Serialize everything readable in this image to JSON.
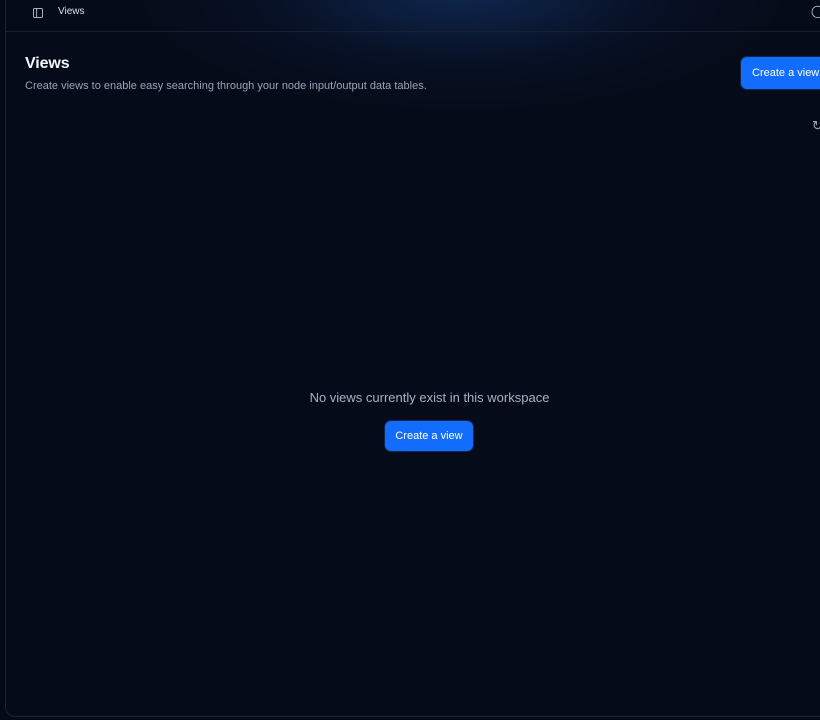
{
  "topbar": {
    "breadcrumb": "Views",
    "sidebar_icon": "sidebar-toggle-icon",
    "right_icon": "user-menu-icon"
  },
  "header": {
    "title": "Views",
    "subtitle": "Create views to enable easy searching through your node input/output data tables.",
    "create_button_label": "Create a view",
    "refresh_icon": "refresh-icon"
  },
  "empty_state": {
    "message": "No views currently exist in this workspace",
    "create_button_label": "Create a view"
  },
  "colors": {
    "page_background": "#040a17",
    "surface": "#050b18",
    "accent": "#126dff",
    "primary_text": "#f3f6fb",
    "secondary_text": "#99a4b7"
  }
}
